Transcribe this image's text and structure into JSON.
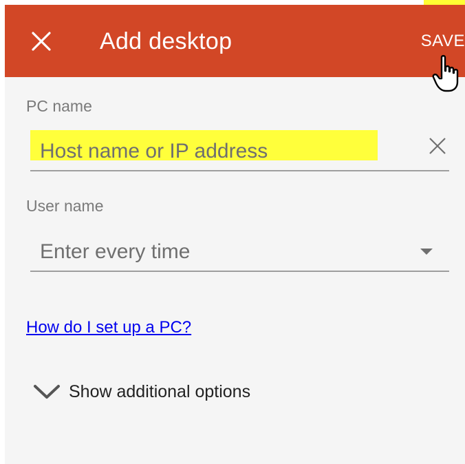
{
  "header": {
    "title": "Add desktop",
    "save_label": "SAVE",
    "close_icon": "close-icon",
    "accent_color": "#d24726"
  },
  "form": {
    "pc_name": {
      "label": "PC name",
      "placeholder": "Host name or IP address",
      "clear_icon": "clear-icon"
    },
    "user_name": {
      "label": "User name",
      "selected_value": "Enter every time",
      "dropdown_icon": "dropdown-arrow-icon"
    }
  },
  "links": {
    "help": "How do I set up a PC?"
  },
  "options": {
    "toggle_label": "Show additional options",
    "toggle_icon": "chevron-down-icon"
  }
}
